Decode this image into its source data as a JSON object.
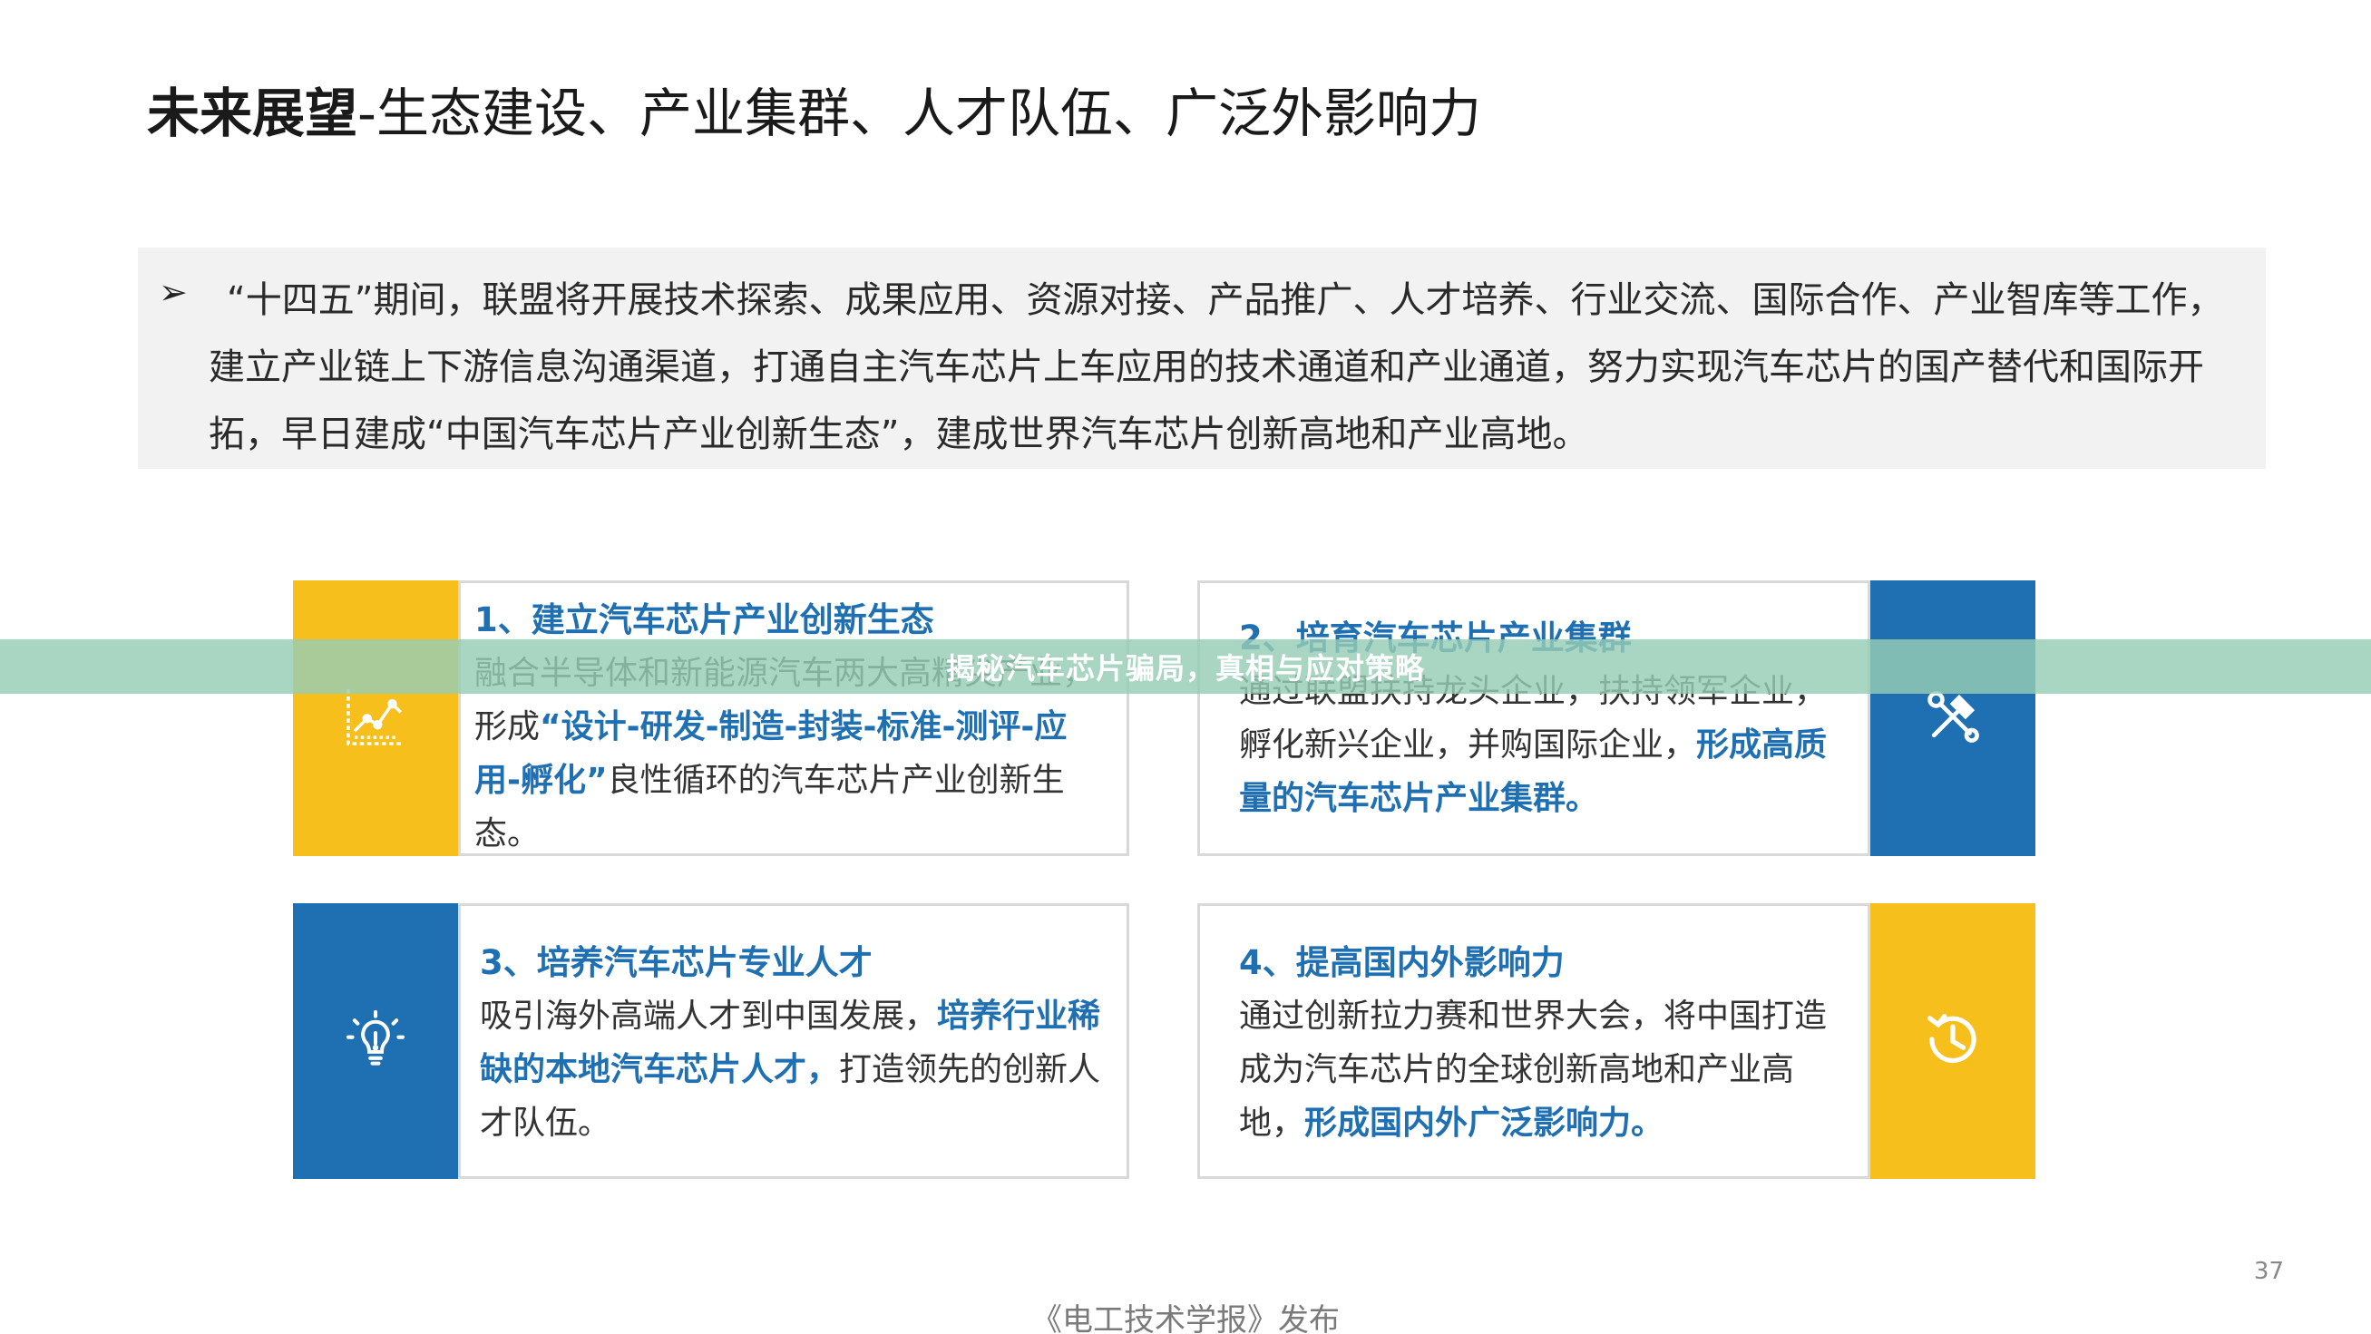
{
  "title": {
    "bold": "未来展望",
    "rest": "-生态建设、产业集群、人才队伍、广泛外影响力"
  },
  "summary": {
    "bullet": "➢",
    "text": "“十四五”期间，联盟将开展技术探索、成果应用、资源对接、产品推广、人才培养、行业交流、国际合作、产业智库等工作，建立产业链上下游信息沟通渠道，打通自主汽车芯片上车应用的技术通道和产业通道，努力实现汽车芯片的国产替代和国际开拓，早日建成“中国汽车芯片产业创新生态”，建成世界汽车芯片创新高地和产业高地。"
  },
  "cards": [
    {
      "title": "1、建立汽车芯片产业创新生态",
      "text_before": "融合半导体和新能源汽车两大高精尖产业，形成",
      "highlight": "“设计-研发-制造-封装-标准-测评-应用-孵化”",
      "text_after": "良性循环的汽车芯片产业创新生态。",
      "icon": "chart-icon",
      "color": "#f7bf1c"
    },
    {
      "title": "2、培育汽车芯片产业集群",
      "text_before": "通过联盟扶持龙头企业，扶持领军企业，孵化新兴企业，并购国际企业，",
      "highlight": "形成高质量的汽车芯片产业集群。",
      "text_after": "",
      "icon": "tools-icon",
      "color": "#1f6fb3"
    },
    {
      "title": "3、培养汽车芯片专业人才",
      "text_before": "吸引海外高端人才到中国发展，",
      "highlight": "培养行业稀缺的本地汽车芯片人才，",
      "text_after": "打造领先的创新人才队伍。",
      "icon": "lightbulb-icon",
      "color": "#1f6fb3"
    },
    {
      "title": "4、提高国内外影响力",
      "text_before": "通过创新拉力赛和世界大会，将中国打造成为汽车芯片的全球创新高地和产业高地，",
      "highlight": "形成国内外广泛影响力。",
      "text_after": "",
      "icon": "history-icon",
      "color": "#f7bf1c"
    }
  ],
  "page_number": "37",
  "footer": "《电工技术学报》发布",
  "overlay": "揭秘汽车芯片骗局，真相与应对策略"
}
